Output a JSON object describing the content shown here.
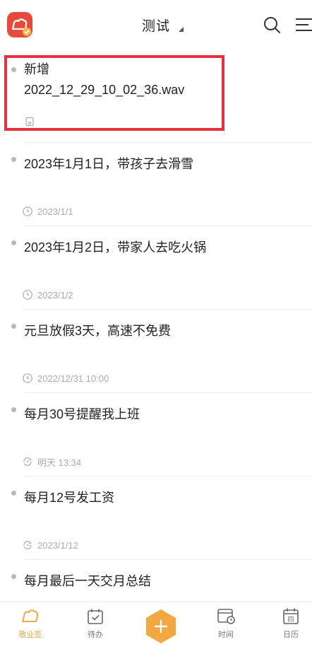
{
  "header": {
    "title": "测试"
  },
  "items": [
    {
      "line1": "新增",
      "line2": "2022_12_29_10_02_36.wav",
      "meta_icon": "audio-file-icon",
      "meta": ""
    },
    {
      "text": "2023年1月1日，带孩子去滑雪",
      "meta_icon": "clock-icon",
      "meta": "2023/1/1"
    },
    {
      "text": "2023年1月2日，带家人去吃火锅",
      "meta_icon": "clock-icon",
      "meta": "2023/1/2"
    },
    {
      "text": "元旦放假3天，高速不免费",
      "meta_icon": "clock-icon",
      "meta": "2022/12/31 10:00"
    },
    {
      "text": "每月30号提醒我上班",
      "meta_icon": "repeat-clock-icon",
      "meta": "明天 13:34"
    },
    {
      "text": "每月12号发工资",
      "meta_icon": "repeat-clock-icon",
      "meta": "2023/1/12"
    },
    {
      "text": "每月最后一天交月总结"
    }
  ],
  "nav": {
    "home": "敬业签",
    "todo": "待办",
    "time": "时间",
    "calendar": "日历",
    "calendar_icon_text": "四"
  },
  "colors": {
    "accent": "#f2a742",
    "highlight": "#e5323e",
    "logo": "#e64a3b"
  }
}
